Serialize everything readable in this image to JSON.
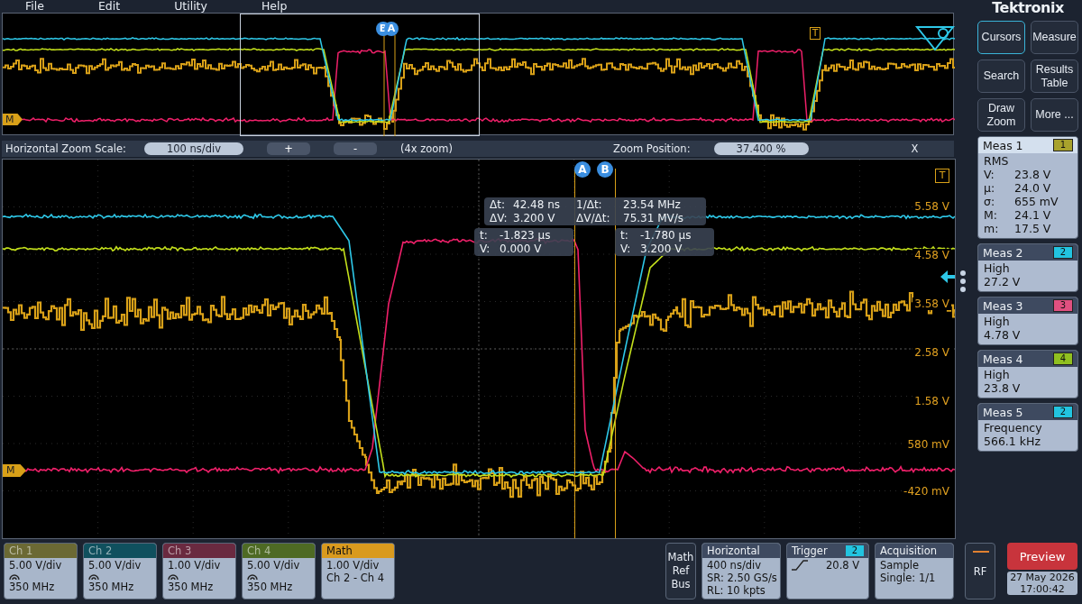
{
  "menu": [
    "File",
    "Edit",
    "Utility",
    "Help"
  ],
  "brand": "Tektronix",
  "overview": {
    "cursor_labels": [
      "B",
      "A"
    ],
    "trigger_label": "T",
    "math_label": "M"
  },
  "zoom_bar": {
    "scale_label": "Horizontal Zoom Scale:",
    "scale_value": "100 ns/div",
    "plus": "+",
    "minus": "-",
    "zoom_factor": "(4x zoom)",
    "position_label": "Zoom Position:",
    "position_value": "37.400 %",
    "close": "X"
  },
  "main_plot": {
    "cursor_labels": [
      "A",
      "B"
    ],
    "trigger_label": "T",
    "math_label": "M",
    "axis_labels": [
      "5.58 V",
      "4.58 V",
      "3.58 V",
      "2.58 V",
      "1.58 V",
      "580 mV",
      "-420 mV"
    ],
    "delta_readout": [
      {
        "label": "Δt:",
        "value": "42.48 ns"
      },
      {
        "label": "1/Δt:",
        "value": "23.54 MHz"
      },
      {
        "label": "ΔV:",
        "value": "3.200 V"
      },
      {
        "label": "ΔV/Δt:",
        "value": "75.31 MV/s"
      }
    ],
    "cursor_readouts": [
      {
        "t_label": "t:",
        "t": "-1.823 µs",
        "v_label": "V:",
        "v": "0.000 V"
      },
      {
        "t_label": "t:",
        "t": "-1.780 µs",
        "v_label": "V:",
        "v": "3.200 V"
      }
    ]
  },
  "side_buttons": [
    {
      "label": "Cursors",
      "selected": true
    },
    {
      "label": "Measure",
      "selected": false
    },
    {
      "label": "Search",
      "selected": false
    },
    {
      "label": "Results Table",
      "selected": false
    },
    {
      "label": "Draw Zoom",
      "selected": false
    },
    {
      "label": "More ...",
      "selected": false
    }
  ],
  "measurements": [
    {
      "title": "Meas 1",
      "source": "1",
      "color": "#a8a22c",
      "selected": true,
      "type": "RMS",
      "rows": [
        {
          "label": "V:",
          "value": "23.8 V"
        },
        {
          "label": "µ:",
          "value": "24.0 V"
        },
        {
          "label": "σ:",
          "value": "655 mV"
        },
        {
          "label": "M:",
          "value": "24.1 V"
        },
        {
          "label": "m:",
          "value": "17.5 V"
        }
      ]
    },
    {
      "title": "Meas 2",
      "source": "2",
      "color": "#22c4e0",
      "selected": false,
      "type": "High",
      "rows": [
        {
          "value": "27.2 V"
        }
      ]
    },
    {
      "title": "Meas 3",
      "source": "3",
      "color": "#e05080",
      "selected": false,
      "type": "High",
      "rows": [
        {
          "value": "4.78 V"
        }
      ]
    },
    {
      "title": "Meas 4",
      "source": "4",
      "color": "#90c020",
      "selected": false,
      "type": "High",
      "rows": [
        {
          "value": "23.8 V"
        }
      ]
    },
    {
      "title": "Meas 5",
      "source": "2",
      "color": "#22c4e0",
      "selected": false,
      "type": "Frequency",
      "rows": [
        {
          "value": "566.1 kHz"
        }
      ]
    }
  ],
  "channels": [
    {
      "kind": "channel",
      "name": "Ch 1",
      "color": "#6b6934",
      "scale": "5.00 V/div",
      "bandwidth": "350 MHz"
    },
    {
      "kind": "channel",
      "name": "Ch 2",
      "color": "#10505e",
      "scale": "5.00 V/div",
      "bandwidth": "350 MHz"
    },
    {
      "kind": "channel",
      "name": "Ch 3",
      "color": "#6a2a40",
      "scale": "1.00 V/div",
      "bandwidth": "350 MHz"
    },
    {
      "kind": "channel",
      "name": "Ch 4",
      "color": "#4e6a24",
      "scale": "5.00 V/div",
      "bandwidth": "350 MHz"
    },
    {
      "kind": "math",
      "name": "Math",
      "color": "#d99a1e",
      "scale": "1.00 V/div",
      "expression": "Ch 2 - Ch 4"
    }
  ],
  "math_ref_bus": [
    "Math",
    "Ref",
    "Bus"
  ],
  "horizontal": {
    "title": "Horizontal",
    "lines": [
      "400 ns/div",
      "SR: 2.50 GS/s",
      "RL: 10 kpts"
    ]
  },
  "trigger": {
    "title": "Trigger",
    "source": "2",
    "color": "#22c4e0",
    "level": "20.8 V"
  },
  "acquisition": {
    "title": "Acquisition",
    "lines": [
      "Sample",
      "Single: 1/1"
    ]
  },
  "rf": "RF",
  "preview": "Preview",
  "date": "27 May 2026",
  "time": "17:00:42"
}
